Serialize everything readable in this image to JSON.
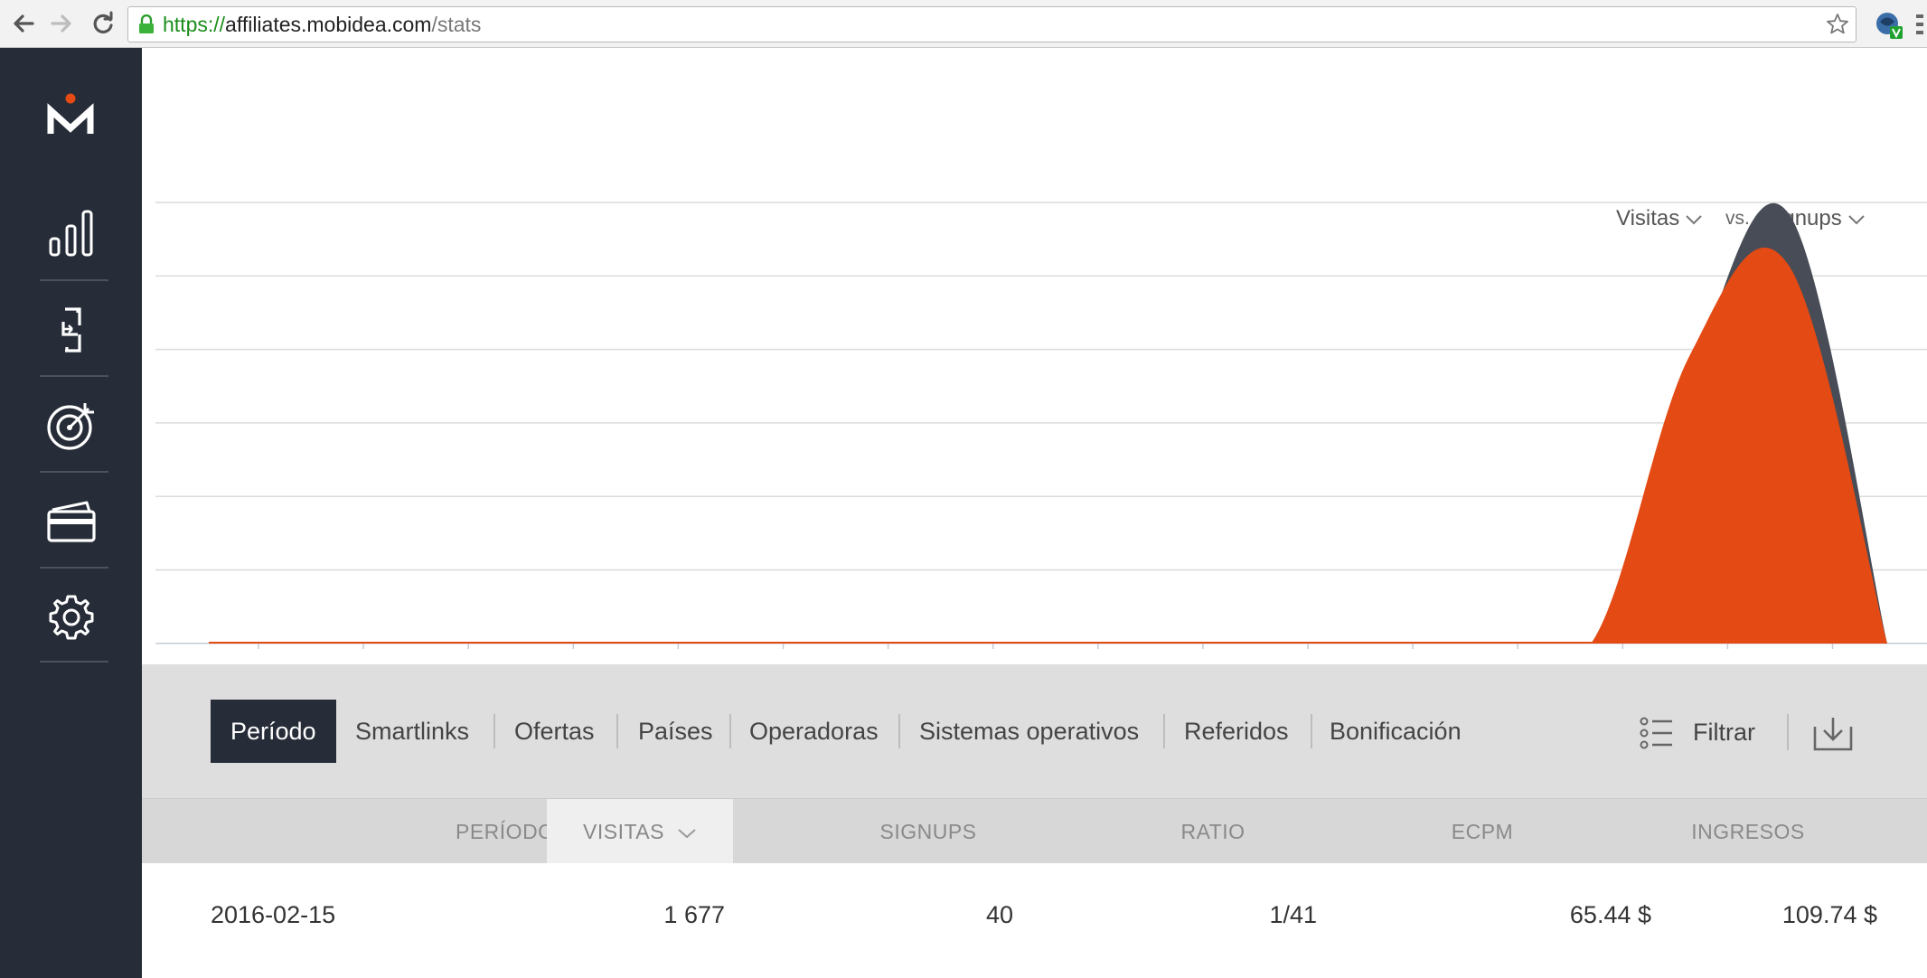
{
  "browser": {
    "url_scheme": "https://",
    "url_host": "affiliates.mobidea.com",
    "url_path": "/stats"
  },
  "chart": {
    "left_metric": "Visitas",
    "vs_label": "vs.",
    "right_metric": "Signups",
    "colors": {
      "visitas": "#474c57",
      "signups": "#e34a14"
    }
  },
  "chart_data": {
    "type": "area",
    "title": "",
    "xlabel": "",
    "ylabel": "",
    "grid": true,
    "point_count": 18,
    "series": [
      {
        "name": "Visitas",
        "values": [
          0,
          0,
          0,
          0,
          0,
          0,
          0,
          0,
          0,
          0,
          0,
          0,
          0,
          0,
          0,
          0.62,
          1.0,
          0
        ]
      },
      {
        "name": "Signups",
        "values": [
          0,
          0,
          0,
          0,
          0,
          0,
          0,
          0,
          0,
          0,
          0,
          0,
          0,
          0,
          0,
          0.67,
          0.88,
          0
        ]
      }
    ]
  },
  "tabs": [
    {
      "label": "Período",
      "active": true
    },
    {
      "label": "Smartlinks"
    },
    {
      "label": "Ofertas"
    },
    {
      "label": "Países"
    },
    {
      "label": "Operadoras"
    },
    {
      "label": "Sistemas operativos"
    },
    {
      "label": "Referidos"
    },
    {
      "label": "Bonificación"
    }
  ],
  "filter_label": "Filtrar",
  "table": {
    "headers": {
      "periodo": "PERÍODO",
      "visitas": "VISITAS",
      "signups": "SIGNUPS",
      "ratio": "RATIO",
      "ecpm": "ECPM",
      "ingresos": "INGRESOS"
    },
    "rows": [
      {
        "periodo": "2016-02-15",
        "visitas": "1 677",
        "signups": "40",
        "ratio": "1/41",
        "ecpm": "65.44 $",
        "ingresos": "109.74 $"
      }
    ]
  },
  "sidebar": {
    "items": [
      "stats-icon",
      "smartlink-icon",
      "offers-target-icon",
      "payments-card-icon",
      "settings-gear-icon"
    ]
  }
}
